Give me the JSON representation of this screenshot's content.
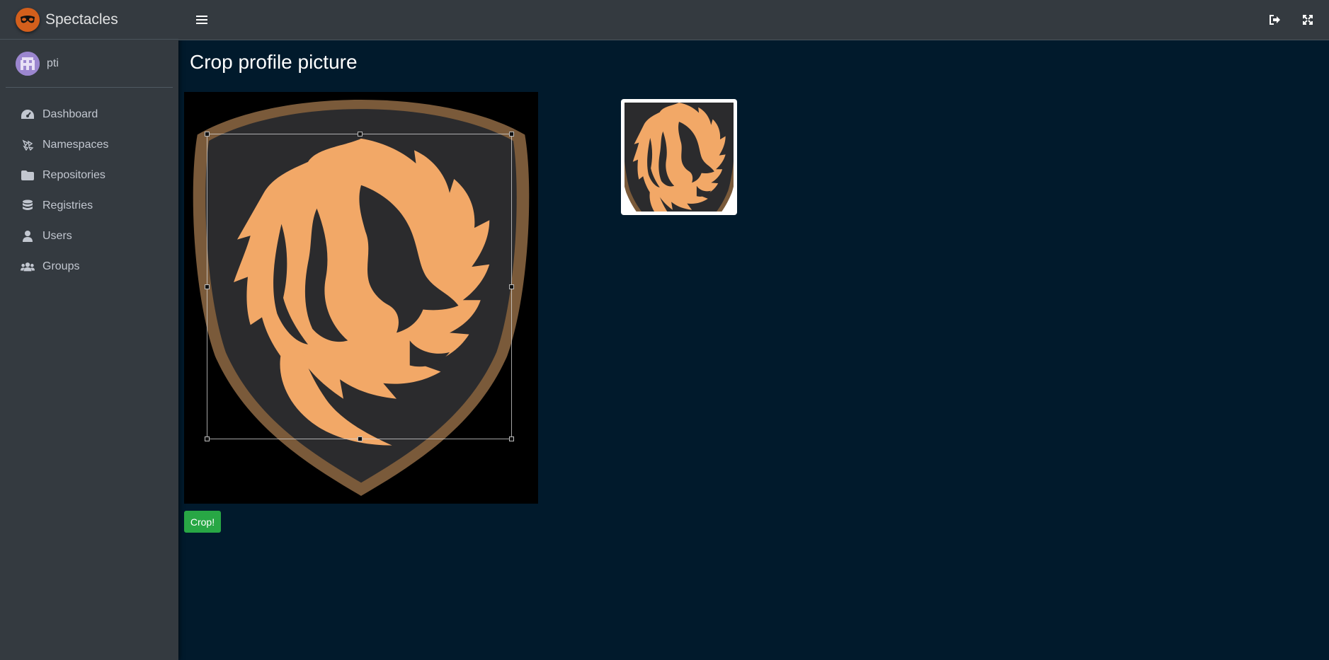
{
  "app": {
    "brand_name": "Spectacles"
  },
  "user": {
    "name": "pti"
  },
  "sidebar": {
    "items": [
      {
        "label": "Dashboard",
        "icon": "dashboard-icon"
      },
      {
        "label": "Namespaces",
        "icon": "namespaces-icon"
      },
      {
        "label": "Repositories",
        "icon": "folder-icon"
      },
      {
        "label": "Registries",
        "icon": "database-icon"
      },
      {
        "label": "Users",
        "icon": "user-icon"
      },
      {
        "label": "Groups",
        "icon": "users-icon"
      }
    ]
  },
  "topbar": {
    "icons": [
      "menu-icon",
      "logout-icon",
      "fullscreen-icon"
    ]
  },
  "page": {
    "title": "Crop profile picture"
  },
  "actions": {
    "crop_label": "Crop!"
  },
  "colors": {
    "accent": "#28a745",
    "brand": "#d35f1c",
    "background": "#011a2c",
    "sidebar": "#343a40",
    "lion": "#f4a460"
  }
}
